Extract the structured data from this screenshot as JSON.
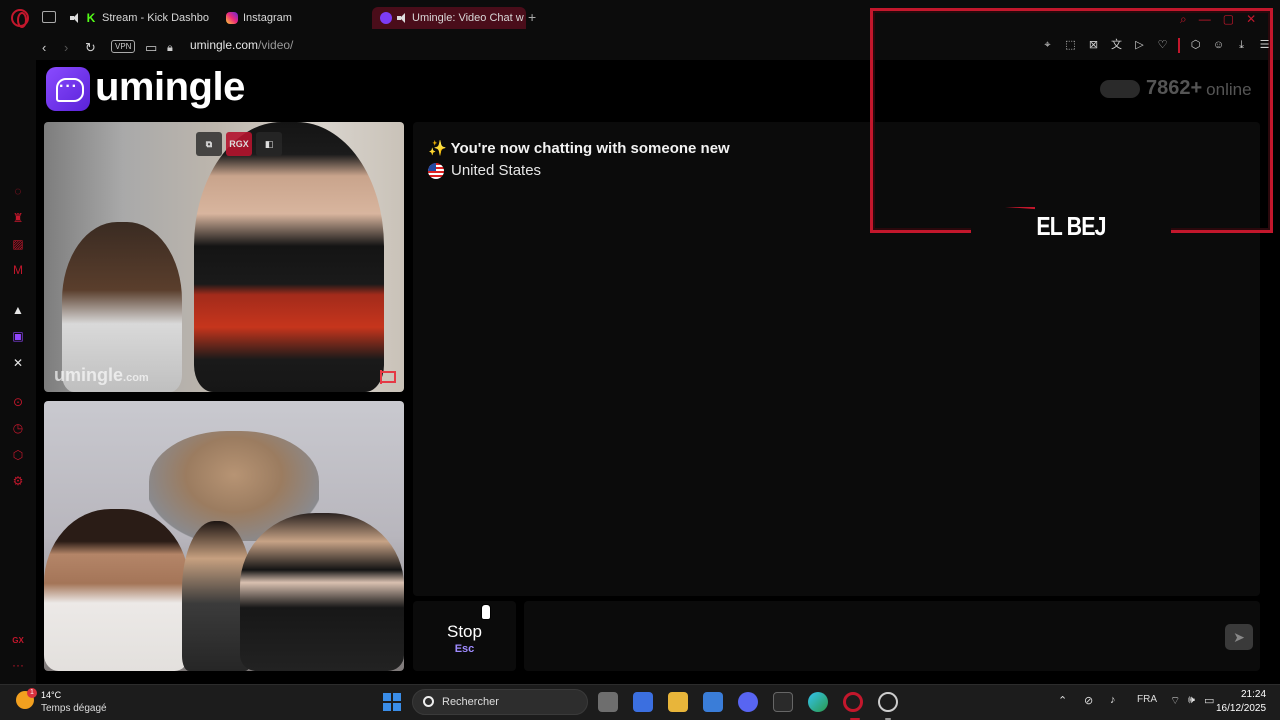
{
  "browser": {
    "tabs": [
      {
        "label": "Stream - Kick Dashbo",
        "favicon": "kick-icon"
      },
      {
        "label": "Instagram",
        "favicon": "instagram-icon"
      },
      {
        "label": "Umingle: Video Chat w",
        "favicon": "umingle-icon",
        "active": true
      }
    ],
    "new_tab": "+",
    "vpn_label": "VPN",
    "url_host": "umingle.com",
    "url_path": "/video/"
  },
  "site": {
    "logo_text": "umingle",
    "online_count": "7862+",
    "online_label": "online"
  },
  "videos": {
    "stranger_watermark": "umingle",
    "stranger_watermark_suffix": ".com",
    "rgx_label": "RGX"
  },
  "chat": {
    "status_message": "✨ You're now chatting with someone new",
    "country": "United States",
    "stop_label": "Stop",
    "stop_key": "Esc",
    "message_placeholder": ""
  },
  "overlay": {
    "streamer_name": "EL BEJ",
    "accent_color": "#c3172c"
  },
  "sidebar": {
    "bottom_label": "GX"
  },
  "taskbar": {
    "weather_temp": "14°C",
    "weather_desc": "Temps dégagé",
    "weather_badge": "1",
    "search_label": "Rechercher",
    "language": "FRA",
    "time": "21:24",
    "date": "16/12/2025"
  }
}
